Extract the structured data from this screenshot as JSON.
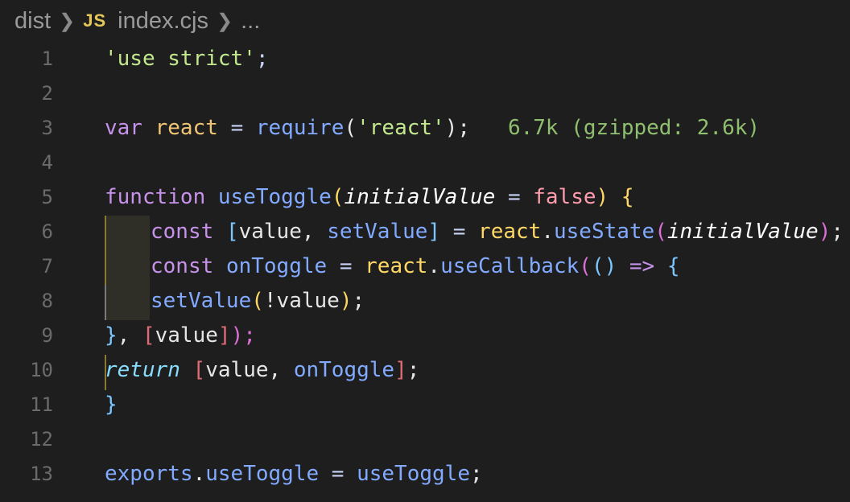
{
  "breadcrumb": {
    "folder": "dist",
    "file_icon": "JS",
    "file": "index.cjs",
    "more": "..."
  },
  "editor": {
    "line_numbers": [
      "1",
      "2",
      "3",
      "4",
      "5",
      "6",
      "7",
      "8",
      "9",
      "10",
      "11",
      "12",
      "13"
    ],
    "lines": {
      "l1": {
        "str": "'use strict'",
        "semi": ";"
      },
      "l3": {
        "kw": "var",
        "name": "react",
        "eq": "=",
        "fn": "require",
        "open": "(",
        "str": "'react'",
        "close": ");",
        "size_hint": "6.7k (gzipped: 2.6k)"
      },
      "l5": {
        "kw": "function",
        "fn": "useToggle",
        "open": "(",
        "param": "initialValue",
        "eq": "=",
        "bool": "false",
        "close": ")",
        "brace": "{"
      },
      "l6": {
        "kw": "const",
        "open": "[",
        "v1": "value",
        "comma": ",",
        "v2": "setValue",
        "close": "]",
        "eq": "=",
        "obj": "react",
        "dot": ".",
        "fn": "useState",
        "p1": "(",
        "param": "initialValue",
        "p2": ")",
        "semi": ";"
      },
      "l7": {
        "kw": "const",
        "name": "onToggle",
        "eq": "=",
        "obj": "react",
        "dot": ".",
        "fn": "useCallback",
        "p1": "(",
        "arrow_params": "()",
        "arrow": "=>",
        "brace": "{"
      },
      "l8": {
        "fn": "setValue",
        "open": "(",
        "bang": "!",
        "v": "value",
        "close": ")",
        "semi": ";"
      },
      "l9": {
        "brace": "}",
        "comma": ",",
        "open": "[",
        "v": "value",
        "close": "]",
        "end": ");"
      },
      "l10": {
        "kw": "return",
        "open": "[",
        "v1": "value",
        "comma": ",",
        "v2": "onToggle",
        "close": "]",
        "semi": ";"
      },
      "l11": {
        "brace": "}"
      },
      "l13": {
        "obj": "exports",
        "dot": ".",
        "prop": "useToggle",
        "eq": "=",
        "val": "useToggle",
        "semi": ";"
      }
    }
  },
  "colors": {
    "background": "#1e1e1e",
    "string": "#c3e88d",
    "keyword": "#c792ea",
    "function": "#82aaff",
    "variable": "#f0c674",
    "boolean": "#ff9cac",
    "size_hint": "#8fbf6f"
  }
}
